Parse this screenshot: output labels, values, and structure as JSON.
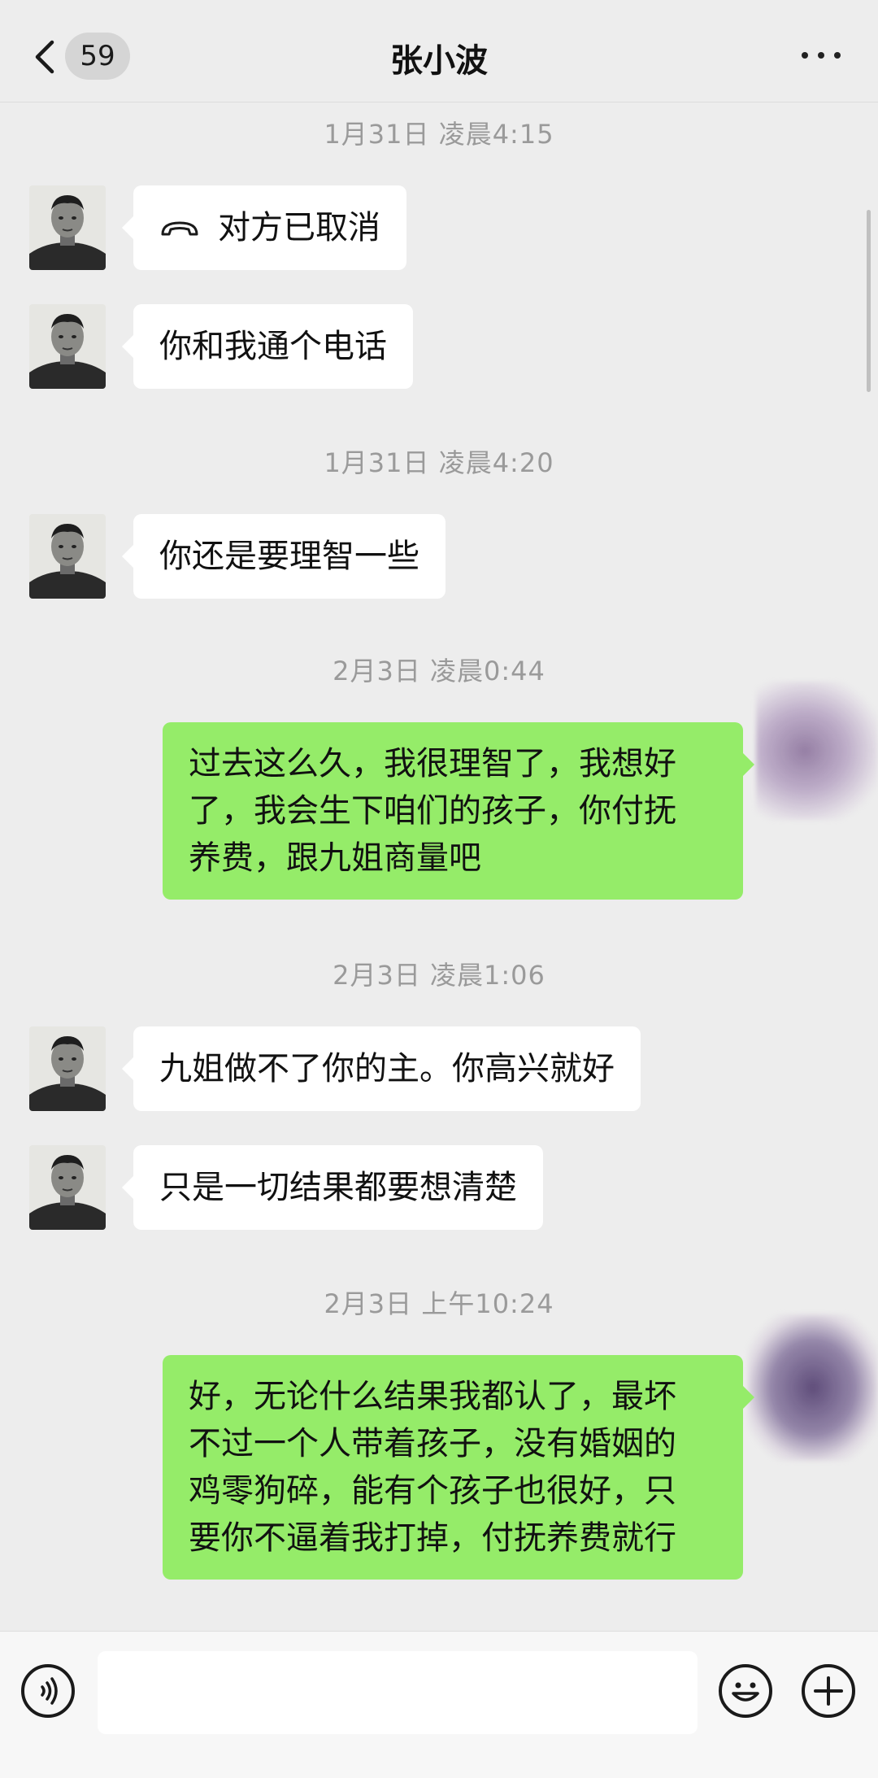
{
  "header": {
    "unread_count": "59",
    "title": "张小波"
  },
  "messages": [
    {
      "type": "time",
      "text": "1月31日 凌晨4:15"
    },
    {
      "type": "in",
      "icon": "call-end-icon",
      "text": "对方已取消"
    },
    {
      "type": "in",
      "text": "你和我通个电话"
    },
    {
      "type": "time",
      "text": "1月31日 凌晨4:20"
    },
    {
      "type": "in",
      "text": "你还是要理智一些"
    },
    {
      "type": "time",
      "text": "2月3日 凌晨0:44"
    },
    {
      "type": "out",
      "lines": [
        "过去这么久，我很理智了，我想好",
        "了，我会生下咱们的孩子，你付抚",
        "养费，跟九姐商量吧"
      ]
    },
    {
      "type": "time",
      "text": "2月3日 凌晨1:06"
    },
    {
      "type": "in",
      "text": "九姐做不了你的主。你高兴就好"
    },
    {
      "type": "in",
      "text": "只是一切结果都要想清楚"
    },
    {
      "type": "time",
      "text": "2月3日 上午10:24"
    },
    {
      "type": "out",
      "lines": [
        "好，无论什么结果我都认了，最坏",
        "不过一个人带着孩子，没有婚姻的",
        "鸡零狗碎，能有个孩子也很好，只",
        "要你不逼着我打掉，付抚养费就行"
      ]
    }
  ],
  "footer": {
    "input_value": ""
  },
  "colors": {
    "background": "#ededed",
    "outgoing_bubble": "#95ec69",
    "incoming_bubble": "#ffffff"
  }
}
